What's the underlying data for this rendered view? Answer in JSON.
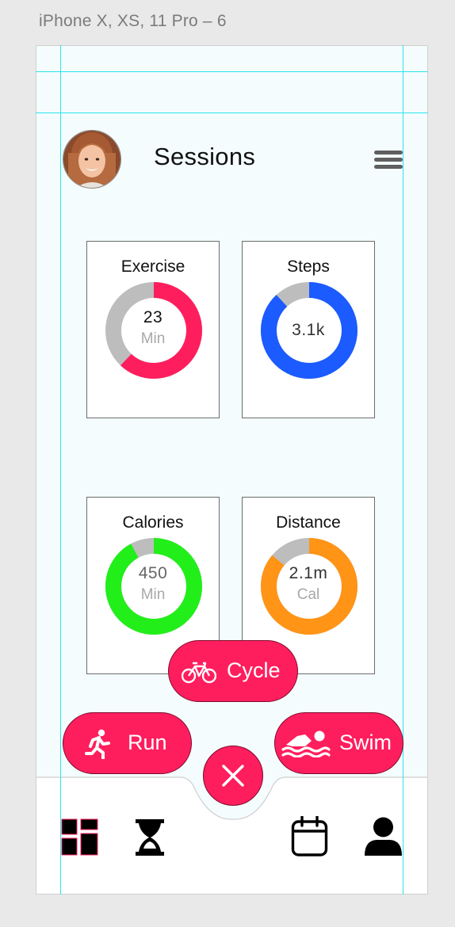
{
  "artboard": {
    "label": "iPhone X, XS, 11 Pro – 6"
  },
  "header": {
    "title": "Sessions",
    "avatar_icon": "user-avatar-photo",
    "menu_icon": "hamburger-menu-icon"
  },
  "cards": [
    {
      "title": "Exercise",
      "value": "23",
      "unit": "Min",
      "progress": 0.62,
      "color": "#ff1e5d"
    },
    {
      "title": "Steps",
      "value": "3.1k",
      "unit": "",
      "progress": 0.88,
      "color": "#1b5bff"
    },
    {
      "title": "Calories",
      "value": "450",
      "unit": "Min",
      "progress": 0.92,
      "color": "#22ee1a"
    },
    {
      "title": "Distance",
      "value": "2.1m",
      "unit": "Cal",
      "progress": 0.86,
      "color": "#ff9417"
    }
  ],
  "actions": {
    "cycle": {
      "label": "Cycle",
      "icon": "bicycle-icon"
    },
    "run": {
      "label": "Run",
      "icon": "running-person-icon"
    },
    "swim": {
      "label": "Swim",
      "icon": "swimming-person-icon"
    },
    "close": {
      "icon": "close-icon"
    }
  },
  "nav": [
    {
      "icon": "dashboard-icon"
    },
    {
      "icon": "hourglass-icon"
    },
    {
      "icon": "calendar-icon"
    },
    {
      "icon": "profile-icon"
    }
  ],
  "colors": {
    "accent": "#ff1e5d",
    "track": "#bdbdbd",
    "guides": "#28e6ee"
  }
}
